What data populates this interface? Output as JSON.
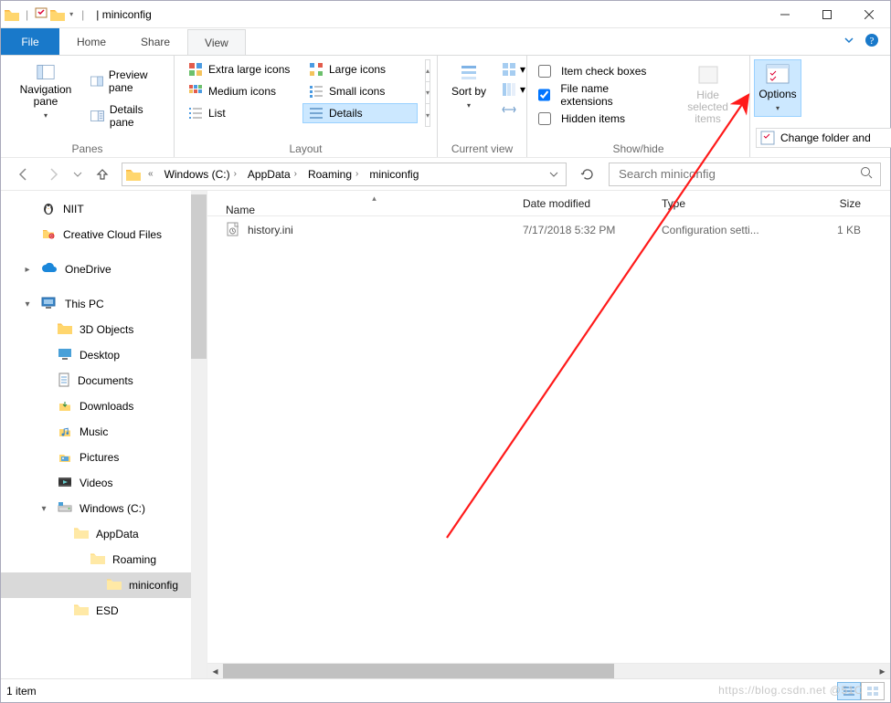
{
  "title_tab_suffix": "| miniconfig",
  "tabs": {
    "file": "File",
    "home": "Home",
    "share": "Share",
    "view": "View"
  },
  "ribbon": {
    "panes": {
      "label": "Panes",
      "nav": "Navigation pane",
      "preview": "Preview pane",
      "details": "Details pane"
    },
    "layout": {
      "label": "Layout",
      "items": [
        "Extra large icons",
        "Large icons",
        "Medium icons",
        "Small icons",
        "List",
        "Details"
      ]
    },
    "currentview": {
      "label": "Current view",
      "sortby": "Sort by",
      "groupby": "",
      "addcols": "",
      "sizecols": ""
    },
    "showhide": {
      "label": "Show/hide",
      "itemcheck": "Item check boxes",
      "ext": "File name extensions",
      "hidden": "Hidden items",
      "hideselected": "Hide selected items"
    },
    "options": {
      "label": "Options",
      "change": "Change folder and"
    }
  },
  "breadcrumb": [
    "Windows (C:)",
    "AppData",
    "Roaming",
    "miniconfig"
  ],
  "search_placeholder": "Search miniconfig",
  "columns": {
    "name": "Name",
    "date": "Date modified",
    "type": "Type",
    "size": "Size"
  },
  "files": [
    {
      "name": "history.ini",
      "date": "7/17/2018 5:32 PM",
      "type": "Configuration setti...",
      "size": "1 KB"
    }
  ],
  "nav": [
    {
      "label": "NIIT",
      "icon": "penguin",
      "indent": 22
    },
    {
      "label": "Creative Cloud Files",
      "icon": "cc",
      "indent": 22
    },
    {
      "label": "OneDrive",
      "icon": "onedrive",
      "indent": 22,
      "exp": "▸",
      "space": true
    },
    {
      "label": "This PC",
      "icon": "pc",
      "indent": 22,
      "exp": "▾",
      "space": true
    },
    {
      "label": "3D Objects",
      "icon": "folder",
      "indent": 40
    },
    {
      "label": "Desktop",
      "icon": "desktop",
      "indent": 40
    },
    {
      "label": "Documents",
      "icon": "docs",
      "indent": 40
    },
    {
      "label": "Downloads",
      "icon": "downloads",
      "indent": 40
    },
    {
      "label": "Music",
      "icon": "music",
      "indent": 40
    },
    {
      "label": "Pictures",
      "icon": "pictures",
      "indent": 40
    },
    {
      "label": "Videos",
      "icon": "videos",
      "indent": 40
    },
    {
      "label": "Windows (C:)",
      "icon": "drive",
      "indent": 40,
      "exp": "▾"
    },
    {
      "label": "AppData",
      "icon": "folderlight",
      "indent": 58
    },
    {
      "label": "Roaming",
      "icon": "folderlight",
      "indent": 76
    },
    {
      "label": "miniconfig",
      "icon": "folderlight",
      "indent": 94,
      "sel": true
    },
    {
      "label": "ESD",
      "icon": "folderlight",
      "indent": 58
    }
  ],
  "status": {
    "count": "1 item"
  },
  "watermark": "https://blog.csdn.net    @51C"
}
